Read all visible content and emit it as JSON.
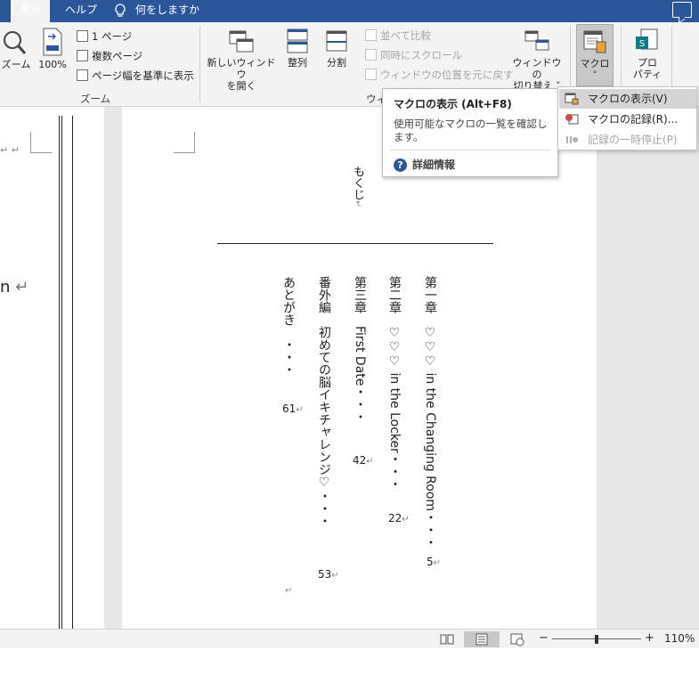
{
  "tabs": {
    "view": "表示",
    "help": "ヘルプ",
    "tell_me": "何をしますか"
  },
  "ribbon": {
    "zoom_btn": "ズーム",
    "zoom100_btn": "100%",
    "one_page": "1 ページ",
    "multi_page": "複数ページ",
    "page_width": "ページ幅を基準に表示",
    "zoom_group": "ズーム",
    "new_window_line1": "新しいウィンドウ",
    "new_window_line2": "を開く",
    "arrange_all": "整列",
    "split": "分割",
    "side_by_side": "並べて比較",
    "sync_scroll": "同時にスクロール",
    "reset_position": "ウィンドウの位置を元に戻す",
    "window_group": "ウィ",
    "switch_windows_line1": "ウィンドウの",
    "switch_windows_line2": "切り替え",
    "macros": "マクロ",
    "properties_line1": "プロ",
    "properties_line2": "パティ"
  },
  "tooltip": {
    "title": "マクロの表示 (Alt+F8)",
    "description": "使用可能なマクロの一覧を確認します。",
    "more_info": "詳細情報"
  },
  "macro_menu": {
    "view_macros": "マクロの表示(V)",
    "record_macro": "マクロの記録(R)...",
    "pause_recording": "記録の一時停止(P)"
  },
  "document": {
    "left_text": "n",
    "toc_title": "もくじ",
    "chapters": [
      {
        "label": "第一章",
        "title": "♡♡♡ in the Changing Room・・・",
        "page": "5"
      },
      {
        "label": "第二章",
        "title": "♡♡♡ in the Locker・・・",
        "page": "22"
      },
      {
        "label": "第三章",
        "title": "First Date・・・",
        "page": "42"
      },
      {
        "label": "番外編",
        "title": "初めての脳イキチャレンジ♡・・・",
        "page": "53"
      },
      {
        "label": "あとがき",
        "title": "・・・",
        "page": "61"
      }
    ]
  },
  "status": {
    "zoom_minus": "−",
    "zoom_plus": "+",
    "zoom_level": "110%",
    "zoom_fraction": 0.5
  },
  "colors": {
    "brand": "#2b579a",
    "ribbon_bg": "#f3f3f3",
    "highlight": "#d5d5d5"
  }
}
